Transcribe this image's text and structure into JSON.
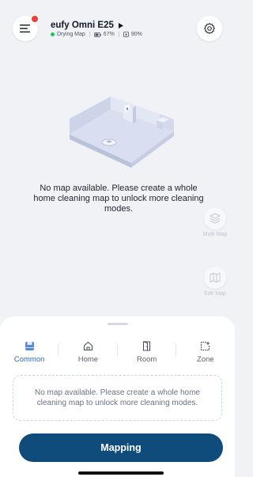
{
  "header": {
    "device_name": "eufy Omni E25",
    "status": {
      "mode": "Drying Map",
      "battery": "67%",
      "water": "90%"
    }
  },
  "map": {
    "no_map_message": "No map available. Please create a whole home cleaning map to unlock more cleaning modes."
  },
  "side_tools": [
    {
      "label": "Multi-Map",
      "icon": "layers-icon"
    },
    {
      "label": "Edit Map",
      "icon": "map-edit-icon"
    }
  ],
  "tabs": [
    {
      "label": "Common",
      "icon": "common-icon",
      "active": true
    },
    {
      "label": "Home",
      "icon": "home-icon",
      "active": false
    },
    {
      "label": "Room",
      "icon": "room-door-icon",
      "active": false
    },
    {
      "label": "Zone",
      "icon": "zone-icon",
      "active": false
    }
  ],
  "sheet": {
    "info_message": "No map available. Please create a whole home cleaning map to unlock more cleaning modes.",
    "primary_button": "Mapping"
  },
  "colors": {
    "accent": "#2f64c5",
    "primary_button": "#0f4c7c",
    "status_ok": "#22c55e",
    "notification": "#e8413b"
  }
}
